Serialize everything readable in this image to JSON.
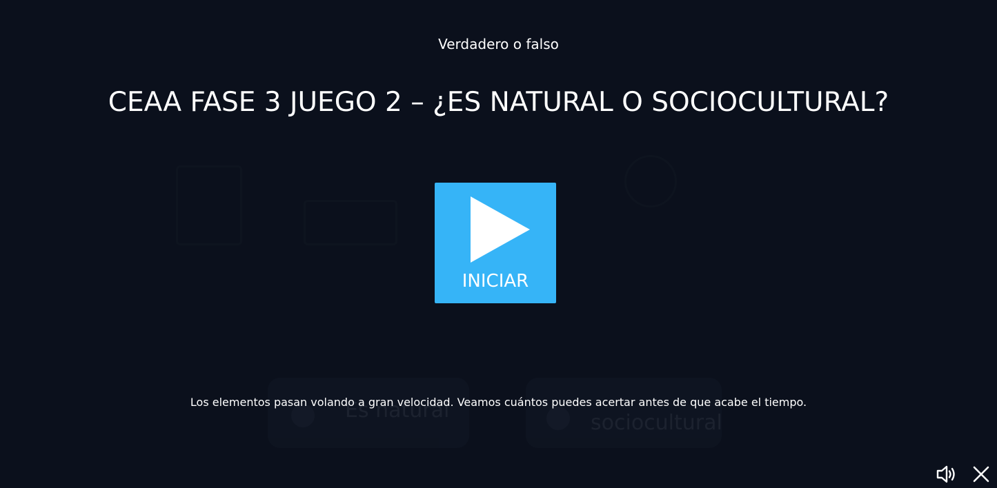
{
  "header": {
    "game_type": "Verdadero o falso",
    "title": "CEAA FASE 3 JUEGO 2 – ¿ES NATURAL O SOCIOCULTURAL?"
  },
  "start_button": {
    "label": "INICIAR",
    "color": "#36b4f7"
  },
  "instructions": {
    "text": "Los elementos pasan volando a gran velocidad. Veamos cuántos puedes acertar antes de que acabe el tiempo."
  },
  "background_cards": {
    "left_label": "Es natural",
    "right_label": "sociocultural"
  },
  "controls": {
    "sound_icon": "speaker-icon",
    "close_icon": "close-icon"
  },
  "colors": {
    "background": "#0b101c",
    "text": "#ffffff"
  }
}
